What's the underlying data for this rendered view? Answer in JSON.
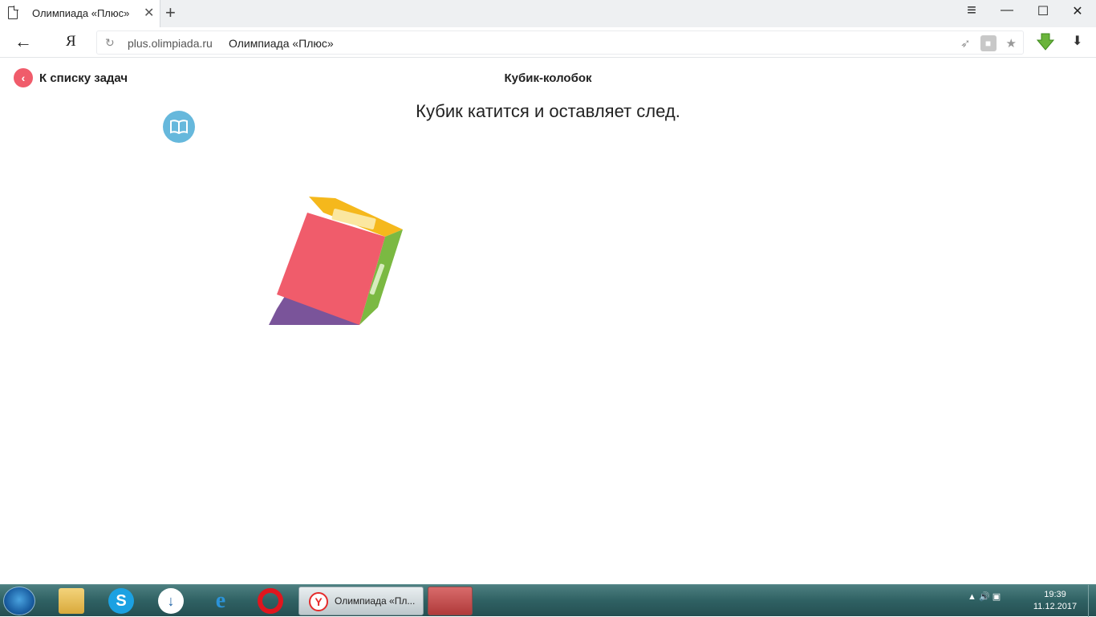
{
  "browser": {
    "tab_title": "Олимпиада «Плюс»",
    "tab_close": "✕",
    "new_tab": "+",
    "menu_icon": "≡",
    "minimize_icon": "—",
    "maximize_icon": "☐",
    "close_icon": "✕",
    "back_icon": "←",
    "logo": "Я",
    "url_host": "plus.olimpiada.ru",
    "url_title": "Олимпиада «Плюс»",
    "reload_icon": "↻",
    "dl_icon": "⬇"
  },
  "page": {
    "back_link_icon": "‹",
    "back_link_label": "К списку задач",
    "task_title": "Кубик-колобок",
    "statement": "Кубик катится и оставляет след."
  },
  "taskbar": {
    "active_task_label": "Олимпиада «Пл...",
    "yandex_icon": "Y",
    "skype_icon": "S",
    "dl_icon": "↓",
    "ie_icon": "e",
    "tray_icons": "▲  🔊  ▣",
    "time": "19:39",
    "date": "11.12.2017"
  },
  "colors": {
    "accent_red": "#f05c6b",
    "book_blue": "#66b8dc",
    "cube_front": "#f05c6b",
    "cube_top": "#f5b81c",
    "cube_side": "#7bb942",
    "cube_trace": "#7a549a"
  }
}
